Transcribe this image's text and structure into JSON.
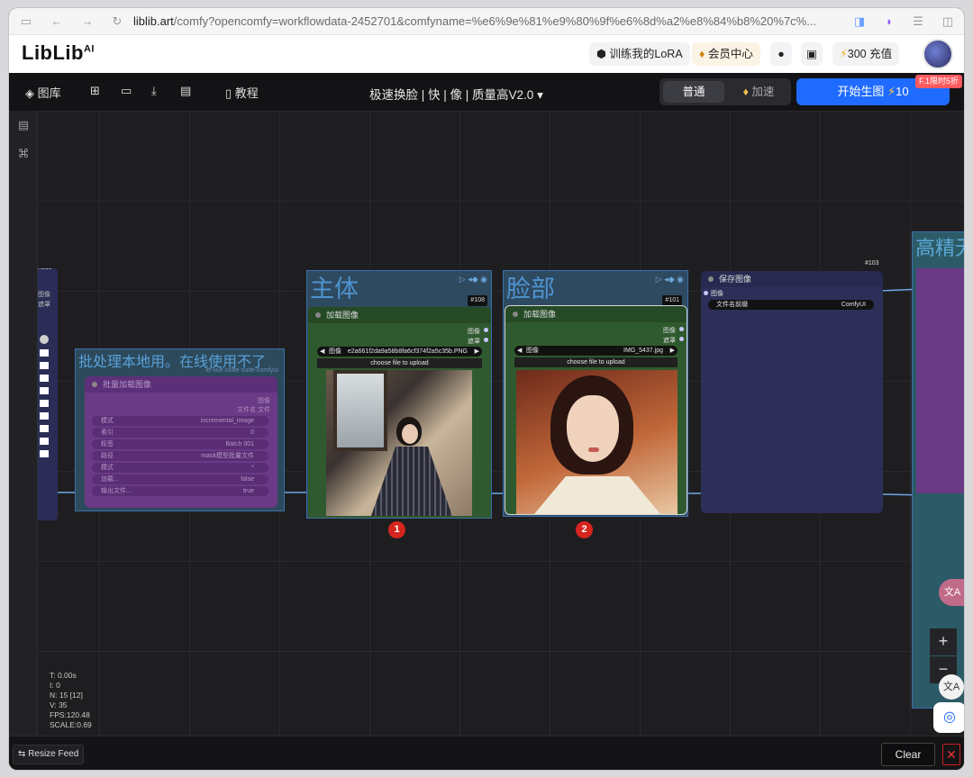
{
  "browser": {
    "url_domain": "liblib.art",
    "url_rest": "/comfy?opencomfy=workflowdata-2452701&comfyname=%e6%9e%81%e9%80%9f%e6%8d%a2%e8%84%b8%20%7c%..."
  },
  "site": {
    "logo": "LibLib",
    "logo_ai": "AI",
    "train_lora": "训练我的LoRA",
    "member": "会员中心",
    "credits": "300 充值"
  },
  "toolbar": {
    "gallery": "图库",
    "tutorial": "教程",
    "workflow_title": "极速换脸 | 快 | 像 | 质量高V2.0",
    "mode_normal": "普通",
    "mode_fast": "加速",
    "generate": "开始生图",
    "generate_cost": "10",
    "promo": "F.1限时5折"
  },
  "canvas": {
    "left_node": {
      "title_fragment": "node",
      "out1": "图像",
      "out2": "遮罩"
    },
    "batch_group": {
      "title": "批处理本地用。在线使用不了",
      "subtitle": "ltf-vue-node-suite-comfyui",
      "inner_title": "批量加载图像",
      "out1": "图像",
      "out2": "文件名 文件",
      "rows": [
        {
          "label": "模式",
          "value": "incremental_image"
        },
        {
          "label": "索引",
          "value": "0"
        },
        {
          "label": "标签",
          "value": "Batch 001"
        },
        {
          "label": "路径",
          "value": "mask模型批量文件"
        },
        {
          "label": "模式",
          "value": "*"
        },
        {
          "label": "加载...",
          "value": "false"
        },
        {
          "label": "输出文件...",
          "value": "true"
        }
      ]
    },
    "subject_group": {
      "title": "主体",
      "node_id": "#108",
      "node_title": "加载图像",
      "out1": "图像",
      "out2": "遮罩",
      "image_label": "图像",
      "image_value": "e2a661f2da9a58b8fa6cf374f2a5c35b.PNG",
      "upload": "choose file to upload",
      "badge": "1"
    },
    "face_group": {
      "title": "脸部",
      "node_id": "#101",
      "node_title": "加载图像",
      "out1": "图像",
      "out2": "遮罩",
      "image_label": "图像",
      "image_value": "IMG_5437.jpg",
      "upload": "choose file to upload",
      "badge": "2"
    },
    "save_node": {
      "node_id": "#103",
      "title": "保存图像",
      "input": "图像",
      "prefix_label": "文件名前缀",
      "prefix_value": "ComfyUI"
    },
    "hd_group": {
      "title": "高精无"
    },
    "stats": [
      "T: 0.00s",
      "I: 0",
      "N: 15 [12]",
      "V: 35",
      "FPS:120.48",
      "SCALE:0.69"
    ]
  },
  "bottom": {
    "resize_feed": "⇆ Resize Feed",
    "clear": "Clear",
    "close": "✕"
  },
  "colors": {
    "accent": "#1f6bff",
    "group_border": "#3b6ea8",
    "badge": "#d6251e",
    "node_green": "#2f5a2f"
  }
}
